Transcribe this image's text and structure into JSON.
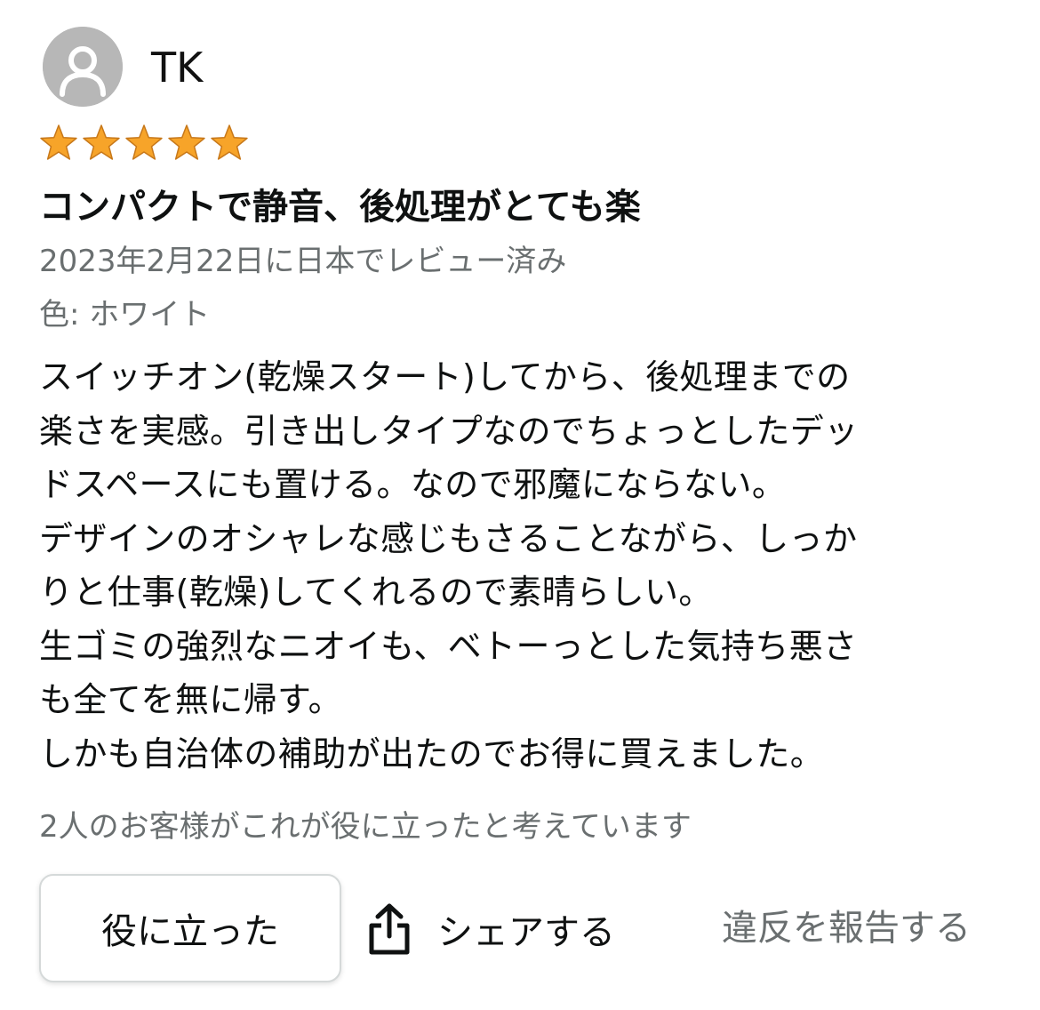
{
  "reviewer": {
    "name": "TK",
    "avatar_icon": "user-silhouette-icon"
  },
  "rating": {
    "stars": 5,
    "max": 5,
    "star_color": "#f7a429"
  },
  "review": {
    "title": "コンパクトで静音、後処理がとても楽",
    "date": "2023年2月22日に日本でレビュー済み",
    "variant": "色: ホワイト",
    "body_lines": [
      "スイッチオン(乾燥スタート)してから、後処理までの",
      "楽さを実感。引き出しタイプなのでちょっとしたデッ",
      "ドスペースにも置ける。なので邪魔にならない。",
      "デザインのオシャレな感じもさることながら、しっか",
      "りと仕事(乾燥)してくれるので素晴らしい。",
      "生ゴミの強烈なニオイも、ベトーっとした気持ち悪さ",
      "も全てを無に帰す。",
      "しかも自治体の補助が出たのでお得に買えました。"
    ]
  },
  "helpful": {
    "count_text": "2人のお客様がこれが役に立ったと考えています",
    "button_label": "役に立った"
  },
  "actions": {
    "share_label": "シェアする",
    "share_icon": "share-icon",
    "report_label": "違反を報告する"
  }
}
